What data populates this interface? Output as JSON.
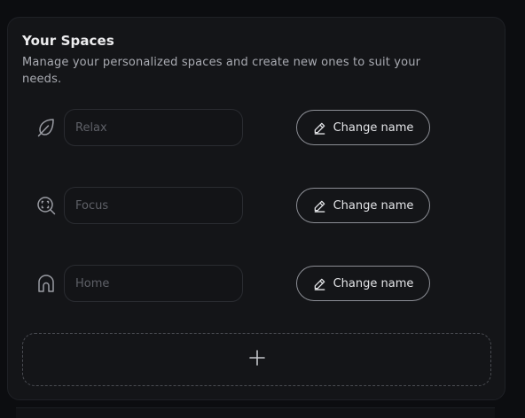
{
  "section": {
    "title": "Your Spaces",
    "subtitle": "Manage your personalized spaces and create new ones to suit your needs."
  },
  "spaces": [
    {
      "icon": "leaf-icon",
      "placeholder": "Relax",
      "value": "",
      "button_label": "Change name"
    },
    {
      "icon": "focus-search-icon",
      "placeholder": "Focus",
      "value": "",
      "button_label": "Change name"
    },
    {
      "icon": "home-icon",
      "placeholder": "Home",
      "value": "",
      "button_label": "Change name"
    }
  ],
  "add_button": {
    "icon": "plus-icon"
  },
  "colors": {
    "background": "#0c0d10",
    "panel": "#141518",
    "text_primary": "#ececee",
    "text_secondary": "#a9abb2",
    "placeholder": "#5e6067",
    "button_border": "#8c8e95"
  }
}
